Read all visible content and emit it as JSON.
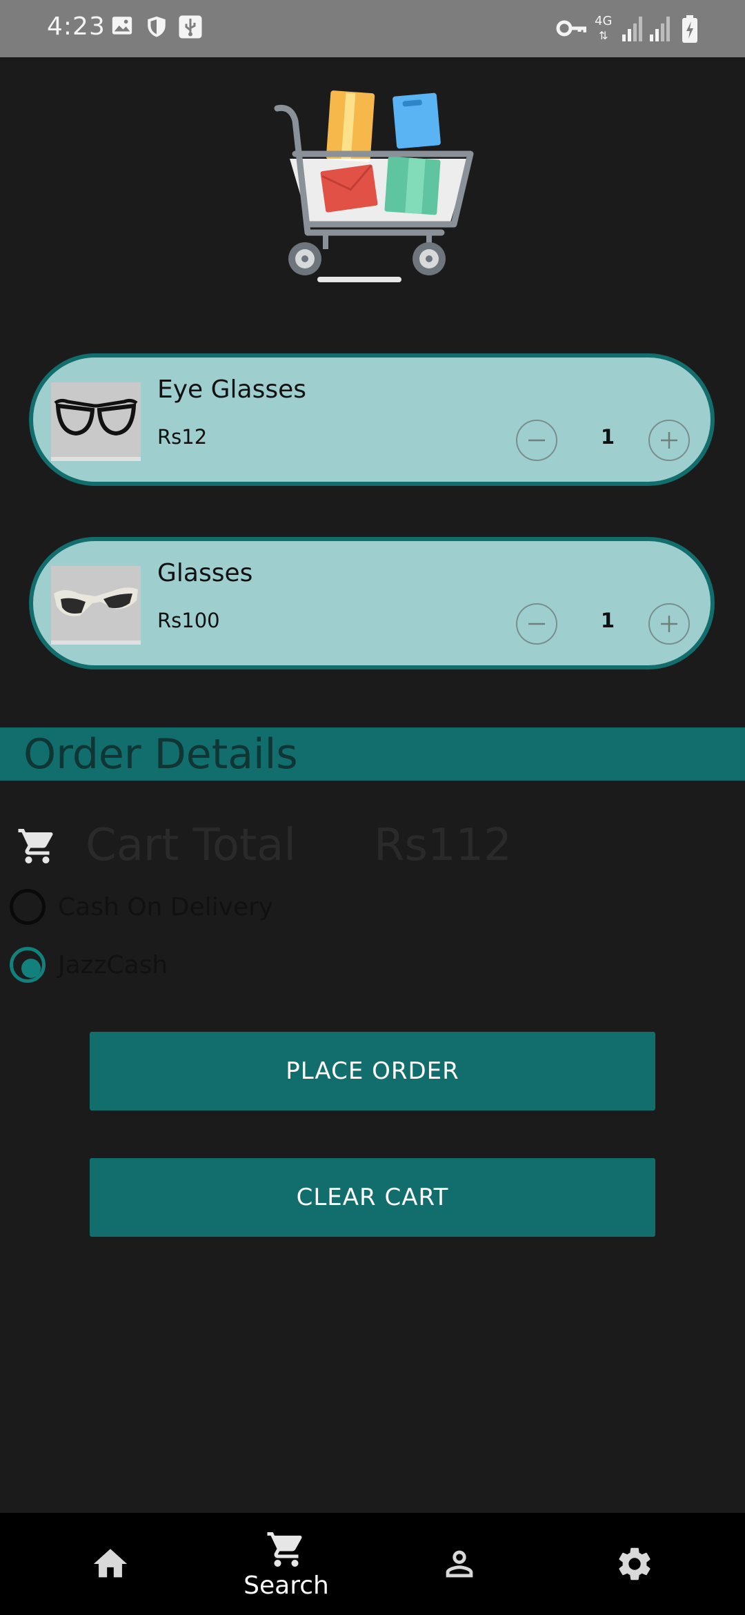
{
  "status_bar": {
    "time": "4:23",
    "network": "4G"
  },
  "cart_items": [
    {
      "name": "Eye Glasses",
      "price": "Rs12",
      "quantity": "1"
    },
    {
      "name": "Glasses",
      "price": "Rs100",
      "quantity": "1"
    }
  ],
  "order_details": {
    "title": "Order Details",
    "cart_total_label": "Cart Total",
    "cart_total_value": "Rs112",
    "payment_options": [
      {
        "label": "Cash On Delivery",
        "selected": false
      },
      {
        "label": "JazzCash",
        "selected": true
      }
    ]
  },
  "buttons": {
    "place_order": "PLACE ORDER",
    "clear_cart": "CLEAR CART"
  },
  "bottom_nav": [
    {
      "icon": "home-icon",
      "label": ""
    },
    {
      "icon": "cart-icon",
      "label": "Search"
    },
    {
      "icon": "person-icon",
      "label": ""
    },
    {
      "icon": "gear-icon",
      "label": ""
    }
  ],
  "colors": {
    "background": "#1b1b1c",
    "accent": "#126d6d",
    "card_fill": "#9ecfce",
    "status_bar": "#7d7d7d"
  }
}
